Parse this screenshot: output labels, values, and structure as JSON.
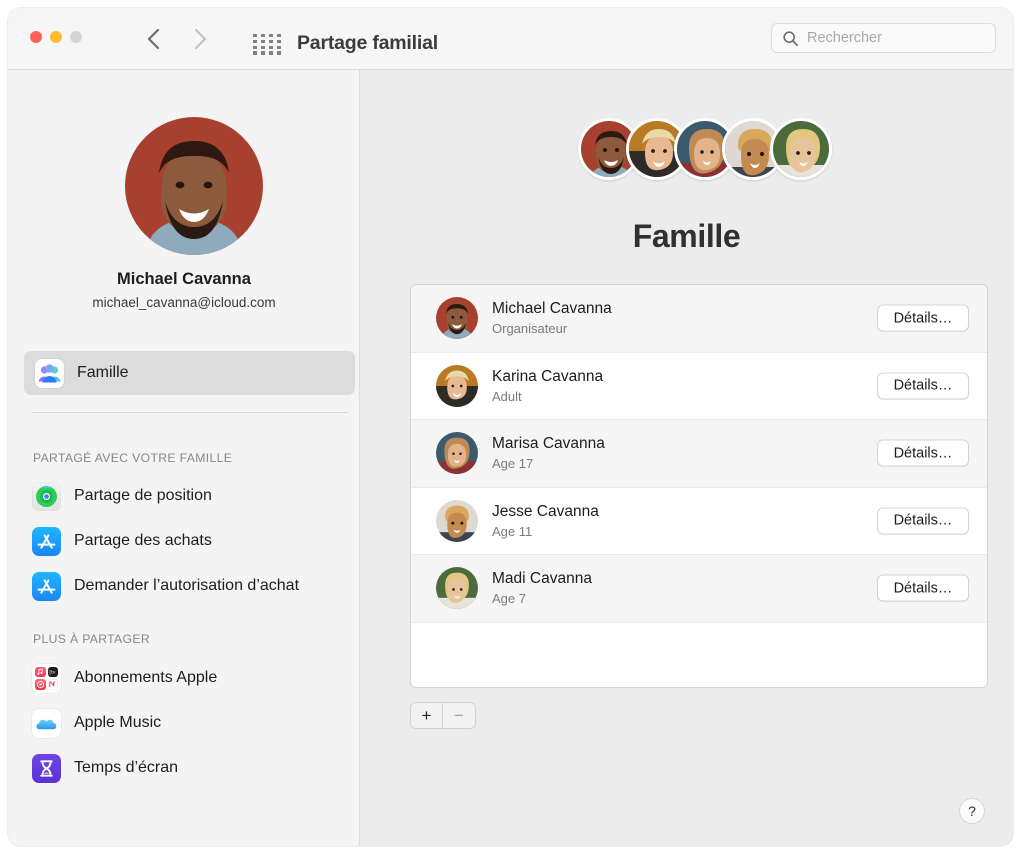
{
  "window": {
    "title": "Partage familial",
    "traffic_lights": [
      "close",
      "minimize",
      "zoom"
    ],
    "back_label": "Précédent",
    "forward_label": "Suivant",
    "grid_label": "Afficher tout"
  },
  "search": {
    "placeholder": "Rechercher",
    "value": "",
    "icon": "search-icon"
  },
  "sidebar": {
    "account": {
      "name": "Michael Cavanna",
      "email": "michael_cavanna@icloud.com",
      "avatar": "michael-avatar"
    },
    "selected_item": {
      "label": "Famille",
      "icon": "family-people-icon"
    },
    "groups": [
      {
        "header": "PARTAGÉ AVEC VOTRE FAMILLE",
        "items": [
          {
            "label": "Partage de position",
            "icon": "find-my-icon"
          },
          {
            "label": "Partage des achats",
            "icon": "app-store-icon"
          },
          {
            "label": "Demander l’autorisation d’achat",
            "icon": "app-store-icon"
          }
        ]
      },
      {
        "header": "PLUS À PARTAGER",
        "items": [
          {
            "label": "Abonnements Apple",
            "icon": "apple-subscriptions-icon"
          },
          {
            "label": "Apple Music",
            "icon": "apple-music-cloud-icon"
          },
          {
            "label": "Temps d’écran",
            "icon": "screen-time-icon"
          }
        ]
      }
    ]
  },
  "main": {
    "title": "Famille",
    "cluster_avatars": [
      "michael-avatar",
      "karina-avatar",
      "marisa-avatar",
      "jesse-avatar",
      "madi-avatar"
    ],
    "members": [
      {
        "name": "Michael Cavanna",
        "role": "Organisateur",
        "details_label": "Détails…",
        "avatar": "michael-avatar"
      },
      {
        "name": "Karina Cavanna",
        "role": "Adult",
        "details_label": "Détails…",
        "avatar": "karina-avatar"
      },
      {
        "name": "Marisa Cavanna",
        "role": "Age 17",
        "details_label": "Détails…",
        "avatar": "marisa-avatar"
      },
      {
        "name": "Jesse Cavanna",
        "role": "Age 11",
        "details_label": "Détails…",
        "avatar": "jesse-avatar"
      },
      {
        "name": "Madi Cavanna",
        "role": "Age 7",
        "details_label": "Détails…",
        "avatar": "madi-avatar"
      }
    ],
    "add_label": "+",
    "remove_label": "−",
    "help_label": "?"
  },
  "colors": {
    "window_bg": "#ececec",
    "sidebar_bg": "#f4f4f4",
    "toolbar_bg": "#f6f6f6",
    "selection": "#dcdcdc",
    "list_row_alt": "#f5f5f5",
    "text_primary": "#1d1d1f",
    "text_secondary": "#7b7b80",
    "traffic_red": "#ff6159",
    "traffic_yellow": "#ffbd2e",
    "traffic_gray": "#d5d5d5"
  }
}
